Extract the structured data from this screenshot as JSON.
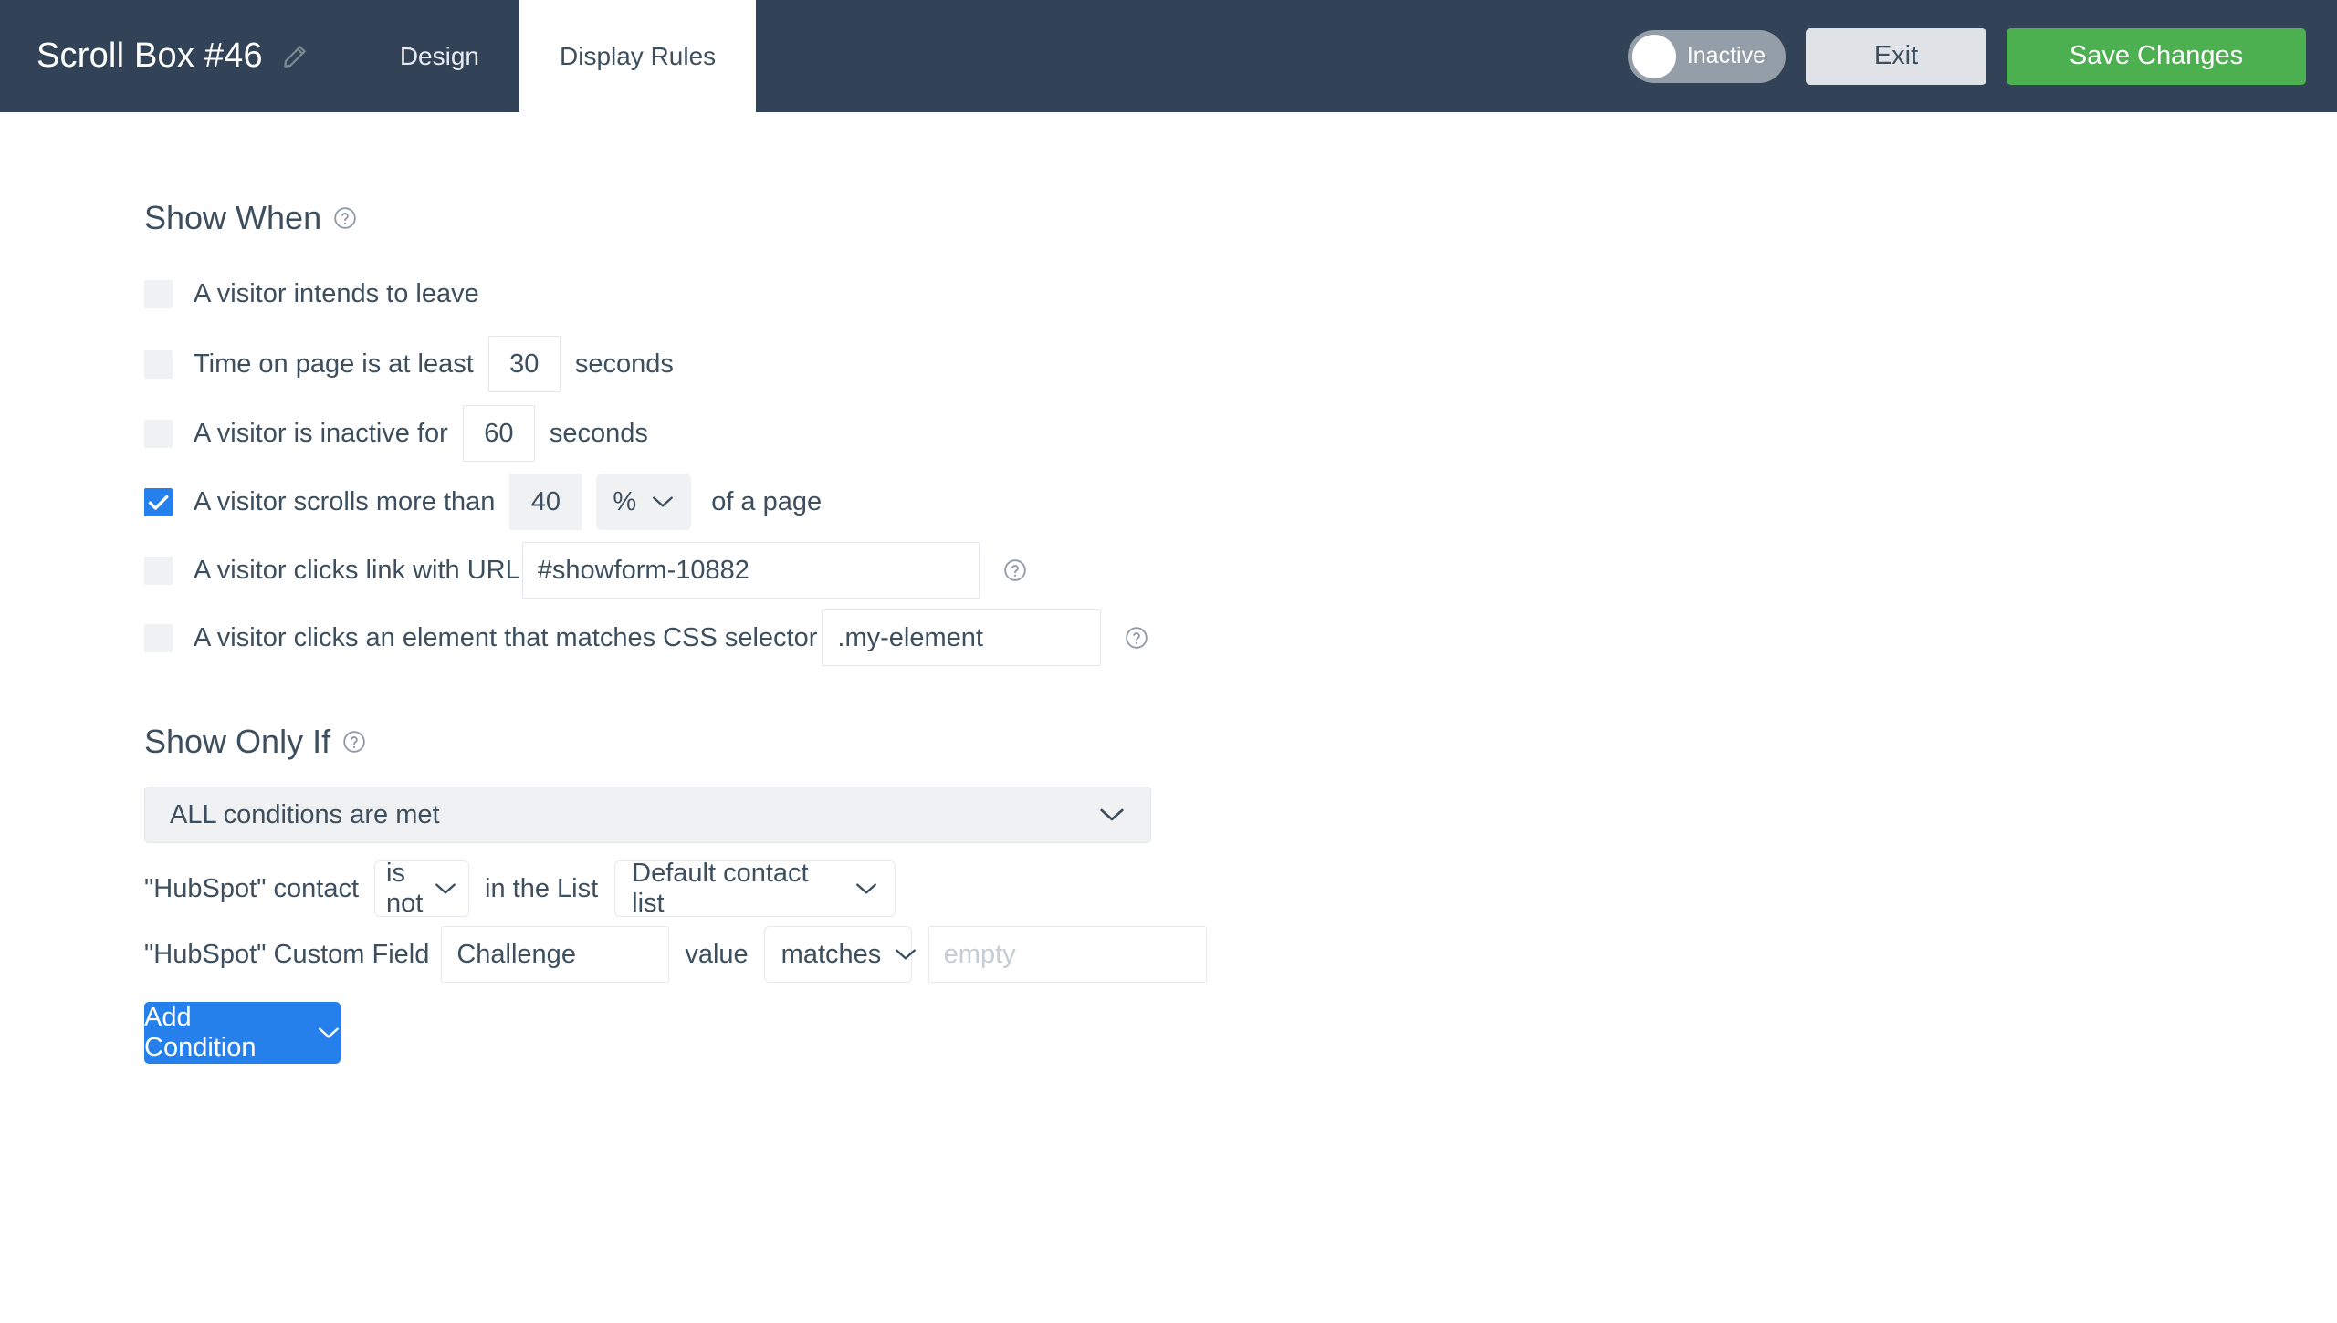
{
  "header": {
    "title": "Scroll Box #46",
    "edit_icon": "pencil-icon",
    "tabs": [
      {
        "label": "Design",
        "active": false
      },
      {
        "label": "Display Rules",
        "active": true
      }
    ],
    "toggle": {
      "label": "Inactive",
      "state": "off"
    },
    "exit_label": "Exit",
    "save_label": "Save Changes",
    "colors": {
      "bar": "#334357",
      "save": "#4caf50",
      "exit": "#dfe3e8",
      "toggle": "#949ea9"
    }
  },
  "show_when": {
    "heading": "Show When",
    "help_icon": "help-circle-icon",
    "rules": [
      {
        "label": "A visitor intends to leave",
        "checked": false
      },
      {
        "label": "Time on page is at least",
        "checked": false,
        "value": "30",
        "suffix": "seconds"
      },
      {
        "label": "A visitor is inactive for",
        "checked": false,
        "value": "60",
        "suffix": "seconds"
      },
      {
        "label": "A visitor scrolls more than",
        "checked": true,
        "value": "40",
        "unit": "%",
        "suffix": "of a page"
      },
      {
        "label": "A visitor clicks link with URL",
        "checked": false,
        "value": "#showform-10882"
      },
      {
        "label": "A visitor clicks an element that matches CSS selector",
        "checked": false,
        "value": ".my-element"
      }
    ]
  },
  "show_only_if": {
    "heading": "Show Only If",
    "help_icon": "help-circle-icon",
    "match_mode": "ALL conditions are met",
    "conditions": [
      {
        "prefix": "\"HubSpot\" contact",
        "operator": "is not",
        "middle": "in the List",
        "list": "Default contact list"
      },
      {
        "prefix": "\"HubSpot\" Custom Field",
        "field_name": "Challenge",
        "middle": "value",
        "operator": "matches",
        "value_placeholder": "empty",
        "value": ""
      }
    ],
    "add_condition_label": "Add Condition",
    "add_condition_color": "#2680eb"
  }
}
